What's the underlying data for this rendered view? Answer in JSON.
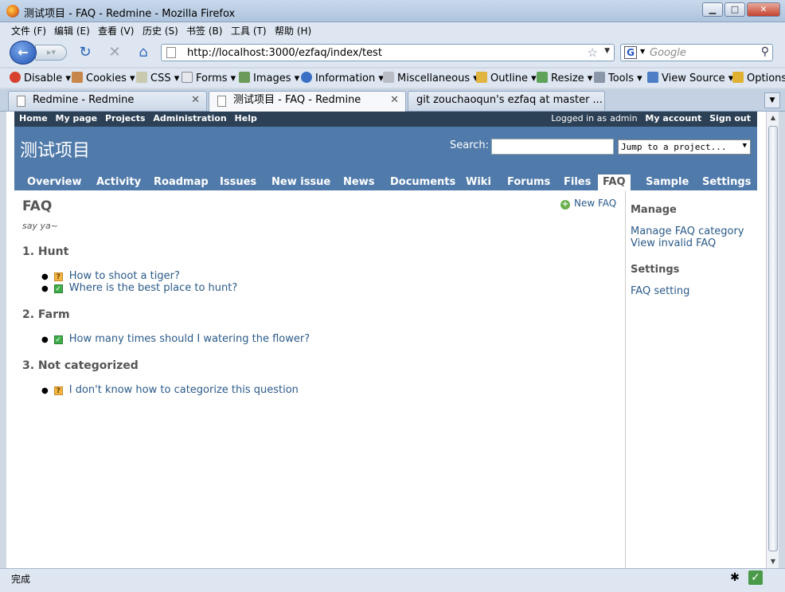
{
  "window": {
    "title": "测试项目 - FAQ - Redmine - Mozilla Firefox",
    "min": "▁",
    "max": "□",
    "close": "✕"
  },
  "menubar": [
    "文件 (F)",
    "编辑 (E)",
    "查看 (V)",
    "历史 (S)",
    "书签 (B)",
    "工具 (T)",
    "帮助 (H)"
  ],
  "nav": {
    "url": "http://localhost:3000/ezfaq/index/test",
    "search_placeholder": "Google"
  },
  "devtoolbar": [
    "Disable",
    "Cookies",
    "CSS",
    "Forms",
    "Images",
    "Information",
    "Miscellaneous",
    "Outline",
    "Resize",
    "Tools",
    "View Source",
    "Options"
  ],
  "tabs": [
    {
      "label": "Redmine - Redmine"
    },
    {
      "label": "测试项目 - FAQ - Redmine"
    },
    {
      "label": "git zouchaoqun's ezfaq at master ..."
    }
  ],
  "topmenu": {
    "left": [
      "Home",
      "My page",
      "Projects",
      "Administration",
      "Help"
    ],
    "logged": "Logged in as",
    "user": "admin",
    "right": [
      "My account",
      "Sign out"
    ]
  },
  "header": {
    "project": "测试项目",
    "search_label": "Search:",
    "jump": "Jump to a project..."
  },
  "mainmenu": [
    "Overview",
    "Activity",
    "Roadmap",
    "Issues",
    "New issue",
    "News",
    "Documents",
    "Wiki",
    "Forums",
    "Files",
    "FAQ",
    "Sample",
    "Settings"
  ],
  "content": {
    "title": "FAQ",
    "subtitle": "say ya~",
    "new_faq": "New FAQ",
    "categories": [
      {
        "name": "1. Hunt",
        "questions": [
          {
            "text": "How to shoot a tiger?",
            "status": "unsolved"
          },
          {
            "text": "Where is the best place to hunt?",
            "status": "solved"
          }
        ]
      },
      {
        "name": "2. Farm",
        "questions": [
          {
            "text": "How many times should I watering the flower?",
            "status": "solved"
          }
        ]
      },
      {
        "name": "3. Not categorized",
        "questions": [
          {
            "text": "I don't know how to categorize this question",
            "status": "unsolved"
          }
        ]
      }
    ]
  },
  "sidebar": {
    "manage_title": "Manage",
    "manage_links": [
      "Manage FAQ category",
      "View invalid FAQ"
    ],
    "settings_title": "Settings",
    "settings_links": [
      "FAQ setting"
    ]
  },
  "status": {
    "text": "完成"
  },
  "icons": {
    "unsolved": "?",
    "solved": "✓"
  },
  "colors": {
    "header": "#507aaa",
    "topmenu": "#2c4056",
    "link": "#2a5a8a"
  }
}
